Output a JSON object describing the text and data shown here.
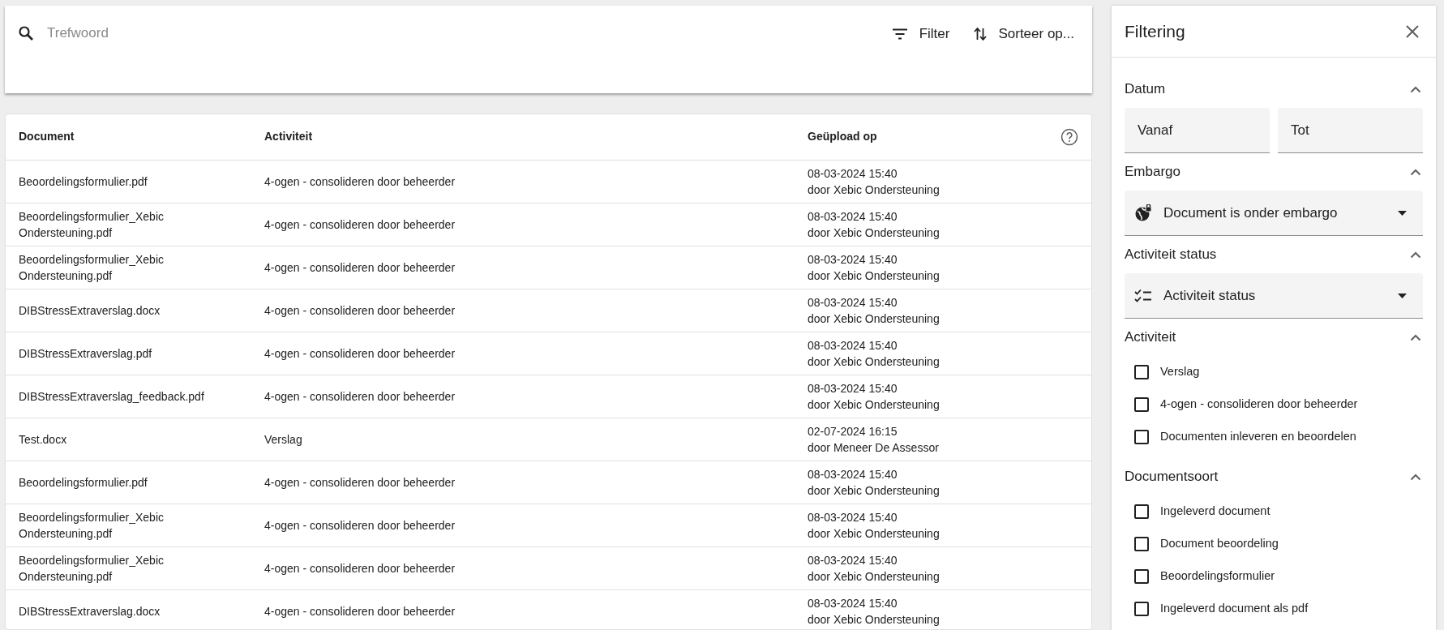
{
  "search": {
    "placeholder": "Trefwoord"
  },
  "toolbar": [
    {
      "kind": "filter",
      "label": "Filter"
    },
    {
      "kind": "sort",
      "label": "Sorteer op..."
    }
  ],
  "table": {
    "columns": [
      "Document",
      "Activiteit",
      "Geüpload op"
    ],
    "rows": [
      {
        "document": "Beoordelingsformulier.pdf",
        "activity": "4-ogen - consolideren door beheerder",
        "date": "08-03-2024 15:40",
        "by": "door Xebic Ondersteuning"
      },
      {
        "document": "Beoordelingsformulier_Xebic Ondersteuning.pdf",
        "activity": "4-ogen - consolideren door beheerder",
        "date": "08-03-2024 15:40",
        "by": "door Xebic Ondersteuning"
      },
      {
        "document": "Beoordelingsformulier_Xebic Ondersteuning.pdf",
        "activity": "4-ogen - consolideren door beheerder",
        "date": "08-03-2024 15:40",
        "by": "door Xebic Ondersteuning"
      },
      {
        "document": "DIBStressExtraverslag.docx",
        "activity": "4-ogen - consolideren door beheerder",
        "date": "08-03-2024 15:40",
        "by": "door Xebic Ondersteuning"
      },
      {
        "document": "DIBStressExtraverslag.pdf",
        "activity": "4-ogen - consolideren door beheerder",
        "date": "08-03-2024 15:40",
        "by": "door Xebic Ondersteuning"
      },
      {
        "document": "DIBStressExtraverslag_feedback.pdf",
        "activity": "4-ogen - consolideren door beheerder",
        "date": "08-03-2024 15:40",
        "by": "door Xebic Ondersteuning"
      },
      {
        "document": "Test.docx",
        "activity": "Verslag",
        "date": "02-07-2024 16:15",
        "by": "door Meneer De Assessor"
      },
      {
        "document": "Beoordelingsformulier.pdf",
        "activity": "4-ogen - consolideren door beheerder",
        "date": "08-03-2024 15:40",
        "by": "door Xebic Ondersteuning"
      },
      {
        "document": "Beoordelingsformulier_Xebic Ondersteuning.pdf",
        "activity": "4-ogen - consolideren door beheerder",
        "date": "08-03-2024 15:40",
        "by": "door Xebic Ondersteuning"
      },
      {
        "document": "Beoordelingsformulier_Xebic Ondersteuning.pdf",
        "activity": "4-ogen - consolideren door beheerder",
        "date": "08-03-2024 15:40",
        "by": "door Xebic Ondersteuning"
      },
      {
        "document": "DIBStressExtraverslag.docx",
        "activity": "4-ogen - consolideren door beheerder",
        "date": "08-03-2024 15:40",
        "by": "door Xebic Ondersteuning"
      }
    ]
  },
  "filter_panel": {
    "title": "Filtering",
    "sections": [
      {
        "kind": "dates",
        "title": "Datum",
        "expanded": true,
        "fields": [
          {
            "placeholder": "Vanaf"
          },
          {
            "placeholder": "Tot"
          }
        ]
      },
      {
        "kind": "select",
        "title": "Embargo",
        "expanded": true,
        "label": "Document is onder embargo"
      },
      {
        "kind": "select",
        "title": "Activiteit status",
        "expanded": true,
        "label": "Activiteit status"
      },
      {
        "kind": "checklist",
        "title": "Activiteit",
        "expanded": true,
        "options": [
          {
            "label": "Verslag",
            "checked": false
          },
          {
            "label": "4-ogen - consolideren door beheerder",
            "checked": false
          },
          {
            "label": "Documenten inleveren en beoordelen",
            "checked": false
          }
        ]
      },
      {
        "kind": "checklist",
        "title": "Documentsoort",
        "expanded": true,
        "options": [
          {
            "label": "Ingeleverd document",
            "checked": false
          },
          {
            "label": "Document beoordeling",
            "checked": false
          },
          {
            "label": "Beoordelingsformulier",
            "checked": false
          },
          {
            "label": "Ingeleverd document als pdf",
            "checked": false
          }
        ]
      }
    ]
  }
}
